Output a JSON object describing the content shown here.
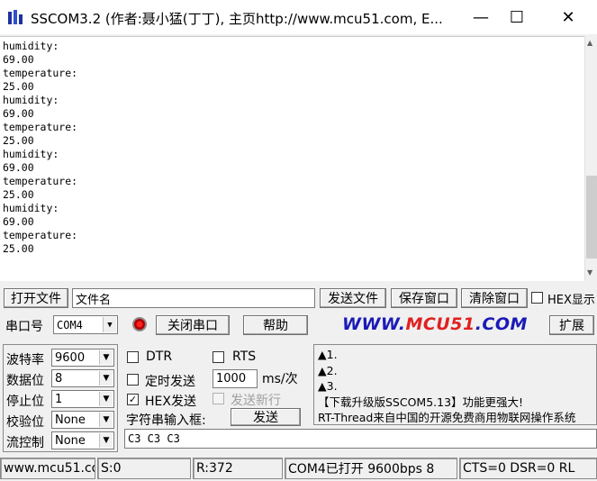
{
  "window": {
    "title": "SSCOM3.2 (作者:聂小猛(丁丁), 主页http://www.mcu51.com, E...",
    "minimize": "—",
    "maximize": "☐",
    "close": "✕"
  },
  "output_lines": [
    "humidity:",
    "69.00",
    "temperature:",
    "25.00",
    "humidity:",
    "69.00",
    "temperature:",
    "25.00",
    "humidity:",
    "69.00",
    "temperature:",
    "25.00",
    "humidity:",
    "69.00",
    "temperature:",
    "25.00"
  ],
  "file_row": {
    "open_file": "打开文件",
    "file_name": "文件名",
    "send_file": "发送文件",
    "save_window": "保存窗口",
    "clear_window": "清除窗口",
    "hex_display": "HEX显示"
  },
  "port_row": {
    "port_label": "串口号",
    "port_value": "COM4",
    "close_port": "关闭串口",
    "help": "帮助",
    "brand_prefix": "WWW.",
    "brand_mid": "MCU51",
    "brand_suffix": ".COM",
    "expand": "扩展"
  },
  "settings": {
    "baud_label": "波特率",
    "baud_value": "9600",
    "databits_label": "数据位",
    "databits_value": "8",
    "stopbits_label": "停止位",
    "stopbits_value": "1",
    "parity_label": "校验位",
    "parity_value": "None",
    "flow_label": "流控制",
    "flow_value": "None"
  },
  "options": {
    "dtr": "DTR",
    "rts": "RTS",
    "timed_send": "定时发送",
    "interval_value": "1000",
    "interval_unit": "ms/次",
    "hex_send": "HEX发送",
    "send_newline": "发送新行",
    "input_label": "字符串输入框:",
    "send": "发送",
    "input_value": "C3 C3 C3"
  },
  "notice_lines": [
    "▲1.",
    "▲2.",
    "▲3.",
    "【下载升级版SSCOM5.13】功能更强大!",
    "RT-Thread来自中国的开源免费商用物联网操作系统"
  ],
  "statusbar": {
    "site": "www.mcu51.cor",
    "sent": "S:0",
    "received": "R:372",
    "port_status": "COM4已打开  9600bps  8",
    "signals": "CTS=0 DSR=0 RL"
  }
}
